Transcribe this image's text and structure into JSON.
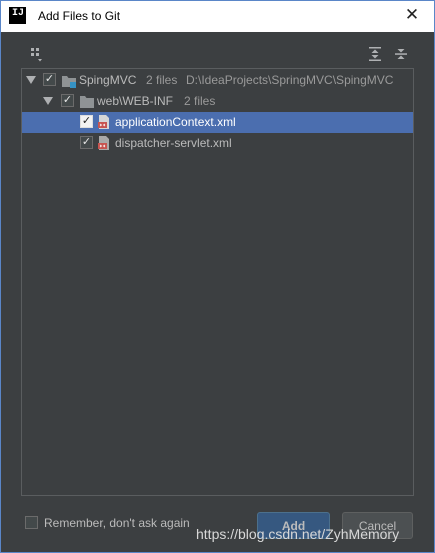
{
  "window": {
    "title": "Add Files to Git",
    "app_icon_letter": "IJ"
  },
  "toolbar": {
    "group_icon": "group-by-module-icon",
    "expand_icon": "expand-all-icon",
    "collapse_icon": "collapse-all-icon"
  },
  "tree": {
    "root": {
      "name": "SpingMVC",
      "count": "2 files",
      "path": "D:\\IdeaProjects\\SpringMVC\\SpingMVC",
      "checked": true
    },
    "folder": {
      "name": "web\\WEB-INF",
      "count": "2 files",
      "checked": true
    },
    "files": [
      {
        "name": "applicationContext.xml",
        "checked": true,
        "selected": true
      },
      {
        "name": "dispatcher-servlet.xml",
        "checked": true,
        "selected": false
      }
    ]
  },
  "footer": {
    "remember_label": "Remember, don't ask again",
    "add_label": "Add",
    "cancel_label": "Cancel"
  },
  "watermark": "https://blog.csdn.net/ZyhMemory",
  "colors": {
    "background": "#3c3f41",
    "selection": "#4b6eaf",
    "default_button": "#365880"
  }
}
